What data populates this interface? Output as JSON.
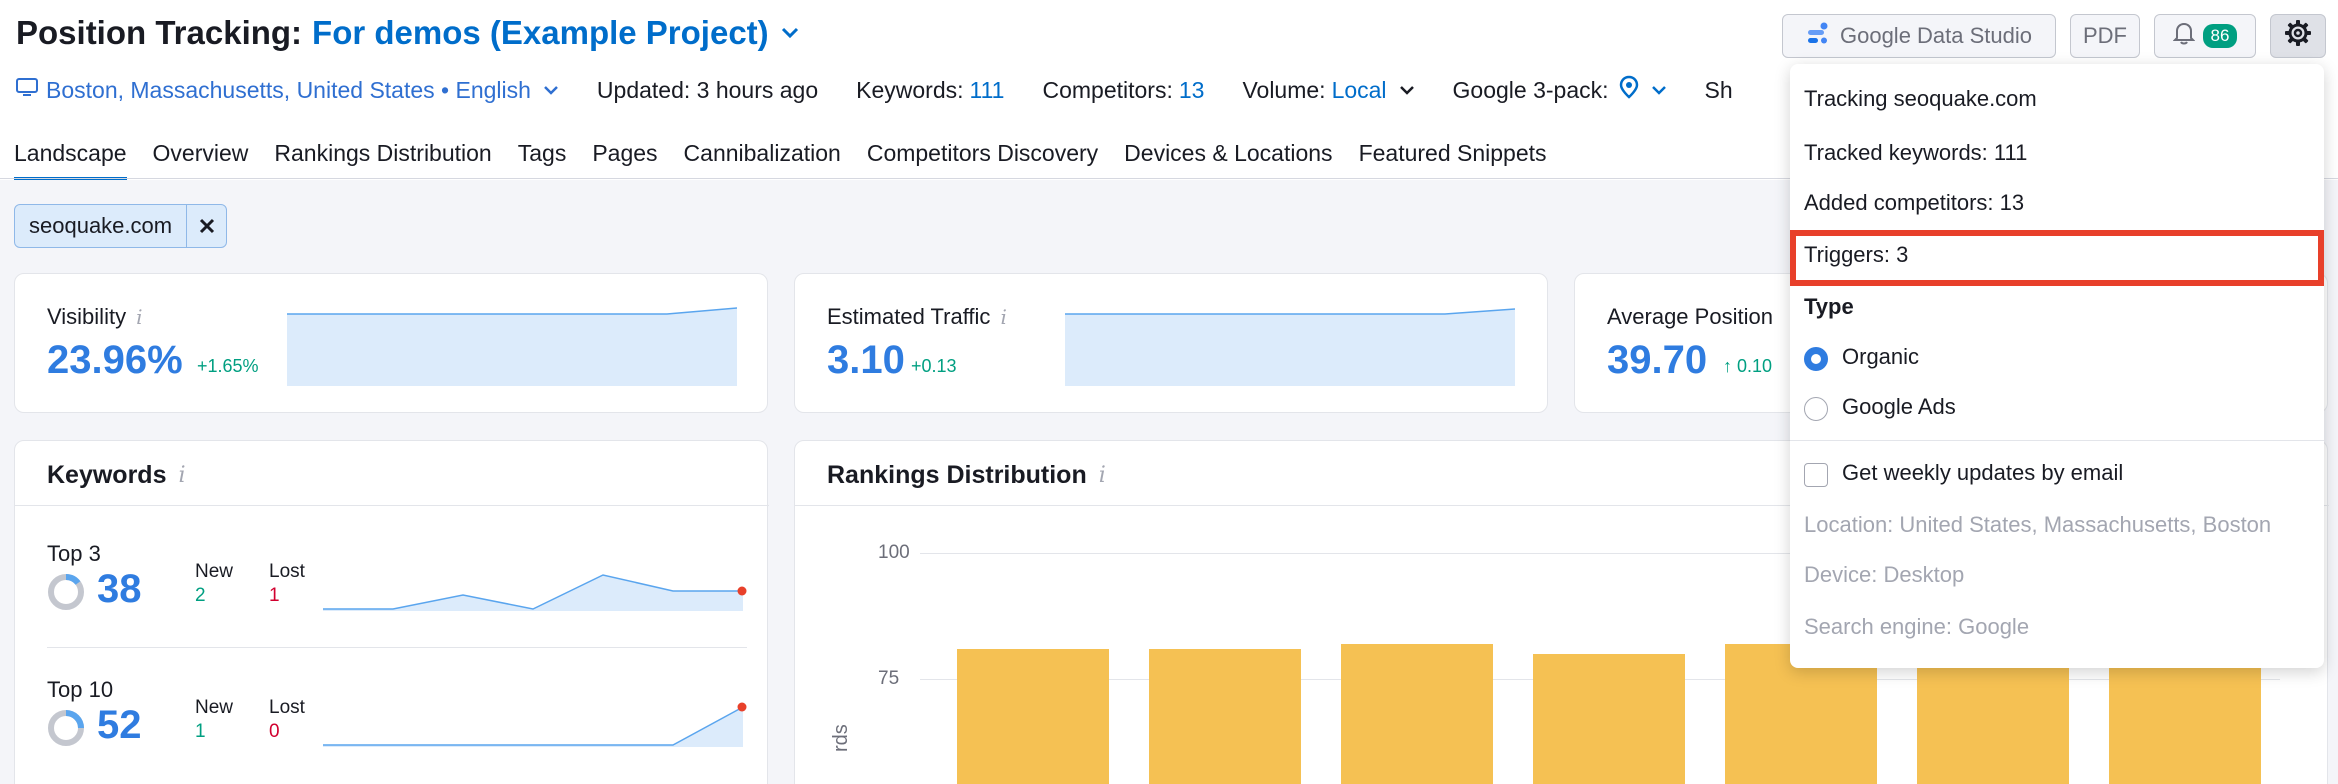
{
  "header": {
    "title_prefix": "Position Tracking:",
    "project_name": "For demos (Example Project)"
  },
  "meta": {
    "location": "Boston, Massachusetts, United States • English",
    "updated": "Updated: 3 hours ago",
    "keywords_label": "Keywords:",
    "keywords_value": "111",
    "competitors_label": "Competitors:",
    "competitors_value": "13",
    "volume_label": "Volume:",
    "volume_value": "Local",
    "google3pack_label": "Google 3-pack:",
    "truncated_label": "Sh"
  },
  "tabs": [
    {
      "label": "Landscape",
      "active": true
    },
    {
      "label": "Overview"
    },
    {
      "label": "Rankings Distribution"
    },
    {
      "label": "Tags"
    },
    {
      "label": "Pages"
    },
    {
      "label": "Cannibalization"
    },
    {
      "label": "Competitors Discovery"
    },
    {
      "label": "Devices & Locations"
    },
    {
      "label": "Featured Snippets"
    }
  ],
  "toolbar": {
    "gds_label": "Google Data Studio",
    "pdf_label": "PDF",
    "notifications_count": "86"
  },
  "filter": {
    "chip_label": "seoquake.com",
    "chip_remove": "✕"
  },
  "cards": {
    "visibility": {
      "title": "Visibility",
      "value": "23.96%",
      "delta": "+1.65%"
    },
    "traffic": {
      "title": "Estimated Traffic",
      "value": "3.10",
      "delta": "+0.13"
    },
    "position": {
      "title": "Average Position",
      "value": "39.70",
      "delta": "↑ 0.10"
    },
    "info_glyph": "i"
  },
  "keywords": {
    "title": "Keywords",
    "rows": [
      {
        "label": "Top 3",
        "value": "38",
        "new_label": "New",
        "new_value": "2",
        "lost_label": "Lost",
        "lost_value": "1"
      },
      {
        "label": "Top 10",
        "value": "52",
        "new_label": "New",
        "new_value": "1",
        "lost_label": "Lost",
        "lost_value": "0"
      }
    ]
  },
  "rankings": {
    "title": "Rankings Distribution",
    "ylabel_fragment": "rds"
  },
  "chart_data": {
    "type": "bar",
    "title": "Rankings Distribution",
    "ylabel": "",
    "yticks": [
      100,
      75
    ],
    "values": [
      81,
      81,
      82,
      80,
      82,
      81,
      81
    ],
    "ylim": [
      50,
      100
    ],
    "grid": true
  },
  "colors": {
    "accent": "#006dca",
    "bar": "#f5c153",
    "positive": "#009f81",
    "negative": "#d1002f",
    "highlight": "#e8402a"
  },
  "dropdown": {
    "tracking": "Tracking seoquake.com",
    "tracked_keywords": "Tracked keywords: 111",
    "added_competitors": "Added competitors: 13",
    "triggers": "Triggers: 3",
    "type_heading": "Type",
    "type_options": [
      {
        "label": "Organic",
        "selected": true
      },
      {
        "label": "Google Ads",
        "selected": false
      }
    ],
    "weekly_updates": "Get weekly updates by email",
    "location": "Location: United States, Massachusetts, Boston",
    "device": "Device: Desktop",
    "search_engine": "Search engine: Google"
  }
}
